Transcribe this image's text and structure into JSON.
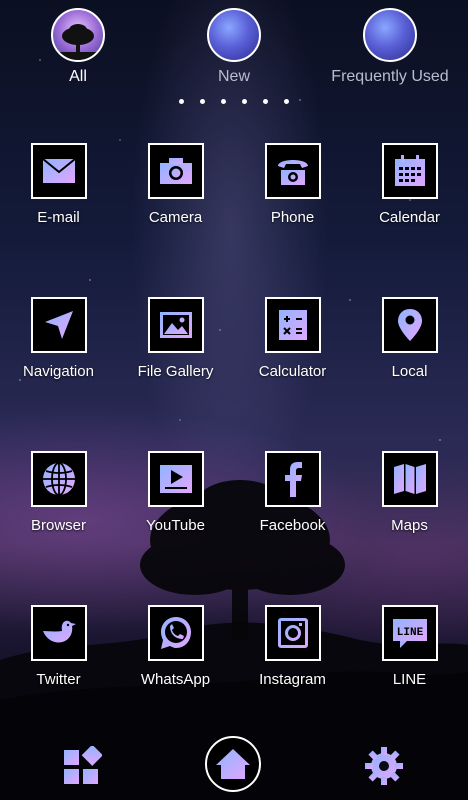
{
  "tabs": [
    {
      "label": "All",
      "icon": "tree-icon",
      "active": true
    },
    {
      "label": "New",
      "icon": "galaxy-icon",
      "active": false
    },
    {
      "label": "Frequently Used",
      "icon": "galaxy-icon",
      "active": false
    }
  ],
  "page_indicator": {
    "count": 6
  },
  "apps": [
    {
      "label": "E-mail",
      "icon": "mail-icon"
    },
    {
      "label": "Camera",
      "icon": "camera-icon"
    },
    {
      "label": "Phone",
      "icon": "phone-icon"
    },
    {
      "label": "Calendar",
      "icon": "calendar-icon"
    },
    {
      "label": "Navigation",
      "icon": "navigation-arrow-icon"
    },
    {
      "label": "File Gallery",
      "icon": "image-icon"
    },
    {
      "label": "Calculator",
      "icon": "calculator-icon"
    },
    {
      "label": "Local",
      "icon": "map-pin-icon"
    },
    {
      "label": "Browser",
      "icon": "globe-icon"
    },
    {
      "label": "YouTube",
      "icon": "video-icon"
    },
    {
      "label": "Facebook",
      "icon": "facebook-icon"
    },
    {
      "label": "Maps",
      "icon": "folded-map-icon"
    },
    {
      "label": "Twitter",
      "icon": "bird-icon"
    },
    {
      "label": "WhatsApp",
      "icon": "whatsapp-icon"
    },
    {
      "label": "Instagram",
      "icon": "instagram-icon"
    },
    {
      "label": "LINE",
      "icon": "line-icon",
      "icon_text": "LINE"
    }
  ],
  "dock": [
    {
      "icon": "widgets-icon"
    },
    {
      "icon": "home-icon"
    },
    {
      "icon": "settings-gear-icon"
    }
  ],
  "colors": {
    "icon_gradient_start": "#8fb4ff",
    "icon_gradient_end": "#e3a6ff",
    "border": "#ffffff",
    "tile_background": "#000000"
  }
}
